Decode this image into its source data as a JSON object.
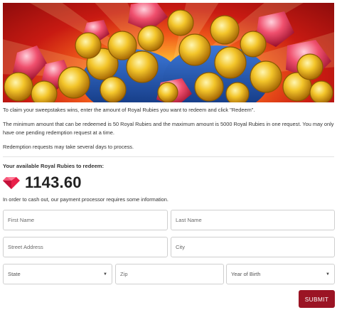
{
  "banner": {
    "alt": "Pots of gold coins with rubies"
  },
  "intro": {
    "claim_text": "To claim your sweepstakes wins, enter the amount of Royal Rubies you want to redeem and click \"Redeem\".",
    "limits_text": "The minimum amount that can be redeemed is 50 Royal Rubies and the maximum amount is 5000 Royal Rubies in one request. You may only have one pending redemption request at a time.",
    "processing_text": "Redemption requests may take several days to process."
  },
  "balance": {
    "label": "Your available Royal Rubies to redeem:",
    "amount": "1143.60"
  },
  "cashout_text": "In order to cash out, our payment processor requires some information.",
  "form": {
    "first_name_placeholder": "First Name",
    "last_name_placeholder": "Last Name",
    "street_placeholder": "Street Address",
    "city_placeholder": "City",
    "state_label": "State",
    "zip_placeholder": "Zip",
    "yob_label": "Year of Birth",
    "submit_label": "SUBMIT"
  },
  "colors": {
    "submit_bg": "#9b1424",
    "ruby": "#e8204a"
  },
  "icons": {
    "ruby": "ruby-gem-icon",
    "caret": "chevron-down-icon"
  }
}
